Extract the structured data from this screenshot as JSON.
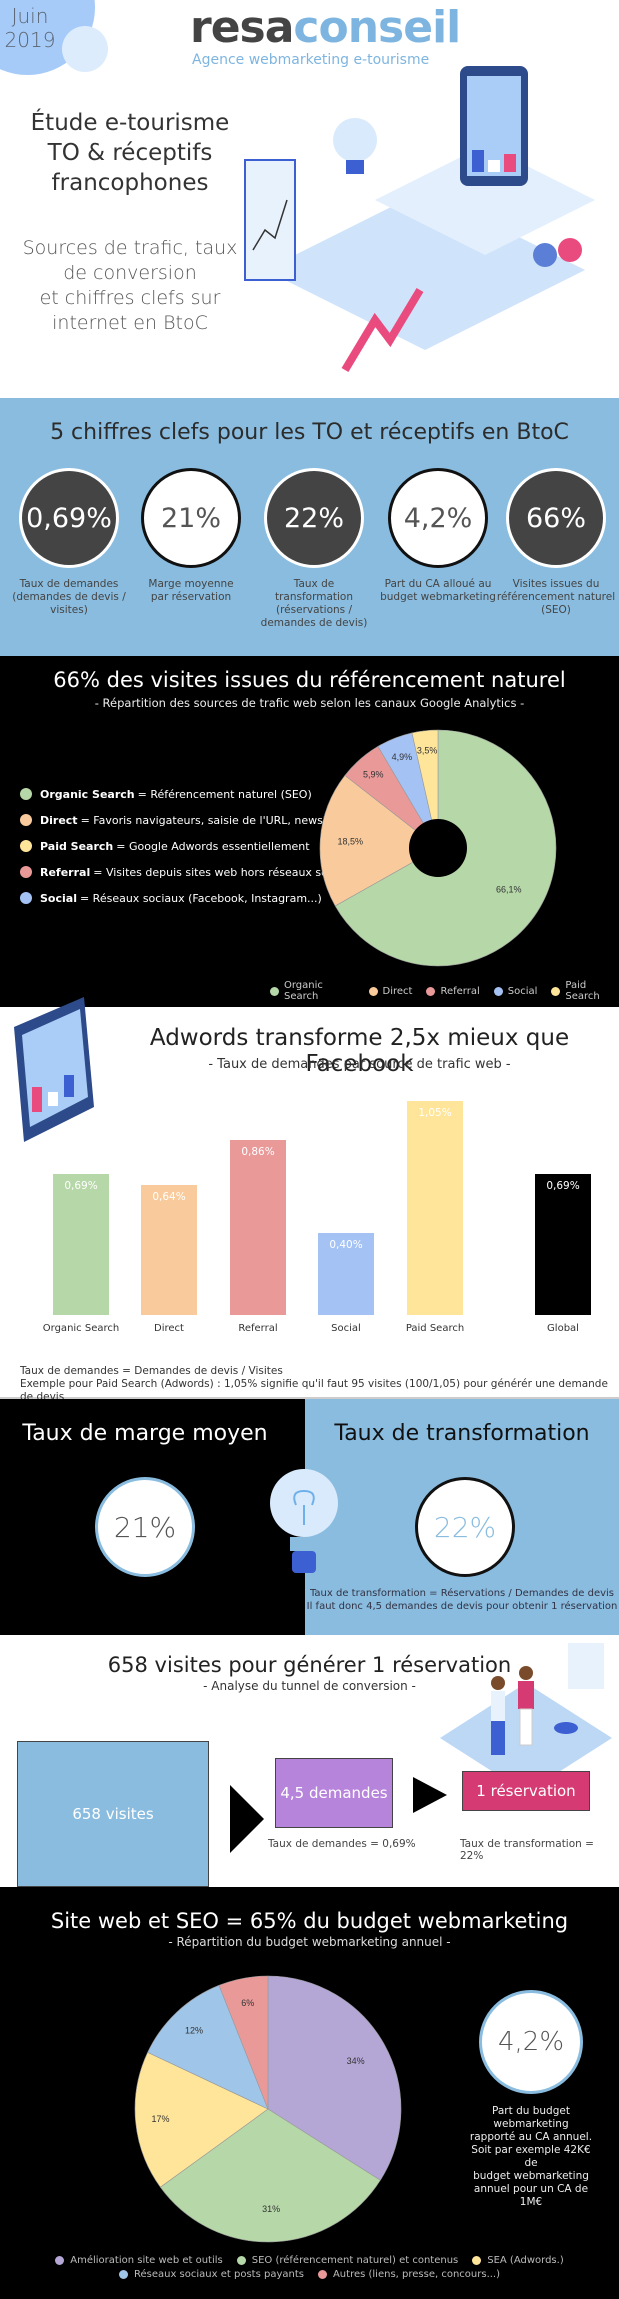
{
  "hero": {
    "date_line1": "Juin",
    "date_line2": "2019",
    "logo_part1": "resa",
    "logo_part2": "conseil",
    "tagline": "Agence webmarketing  e-tourisme",
    "title_lines": [
      "Étude e-tourisme",
      "TO & réceptifs",
      "francophones"
    ],
    "subtitle_lines": [
      "Sources de trafic, taux",
      "de conversion",
      "et chiffres clefs sur",
      "internet en BtoC"
    ]
  },
  "key_figures": {
    "title": "5 chiffres clefs pour les TO et réceptifs en BtoC",
    "items": [
      {
        "value": "0,69%",
        "style": "dark",
        "label_bold": "Taux de demandes",
        "label_rest": "(demandes de devis / visites)"
      },
      {
        "value": "21%",
        "style": "light",
        "label_bold": "Marge moyenne",
        "label_rest": "par réservation"
      },
      {
        "value": "22%",
        "style": "dark",
        "label_bold": "Taux de transformation",
        "label_rest": "(réservations / demandes de devis)"
      },
      {
        "value": "4,2%",
        "style": "light",
        "label_bold": "Part du CA alloué au",
        "label_rest": "budget webmarketing"
      },
      {
        "value": "66%",
        "style": "dark",
        "label_bold": "Visites issues du",
        "label_rest": "référencement naturel (SEO)"
      }
    ]
  },
  "traffic": {
    "title": "66% des visites issues du référencement naturel",
    "subtitle": "- Répartition des sources de trafic web selon les canaux Google Analytics -",
    "definitions": [
      {
        "key": "Organic Search",
        "text": "= Référencement naturel (SEO)",
        "color": "#b6d7a8"
      },
      {
        "key": "Direct",
        "text": "= Favoris navigateurs, saisie de l'URL, newsletters",
        "color": "#f9cb9c"
      },
      {
        "key": "Paid Search",
        "text": "= Google Adwords essentiellement",
        "color": "#ffe599"
      },
      {
        "key": "Referral",
        "text": "=  Visites depuis sites web hors réseaux sociaux",
        "color": "#ea9999"
      },
      {
        "key": "Social",
        "text": "= Réseaux sociaux (Facebook, Instagram...)",
        "color": "#a4c2f4"
      }
    ]
  },
  "adwords": {
    "title": "Adwords transforme 2,5x mieux que Facebook",
    "subtitle": "- Taux de demandes par source de trafic web -",
    "note_line1": "Taux de demandes = Demandes de devis / Visites",
    "note_line2": "Exemple pour Paid Search (Adwords) : 1,05% signifie qu'il faut 95 visites (100/1,05) pour générér une demande de devis"
  },
  "split": {
    "left_title": "Taux de marge moyen",
    "left_value": "21%",
    "right_title": "Taux de transformation",
    "right_value": "22%",
    "right_note_line1": "Taux de transformation = Réservations / Demandes de devis",
    "right_note_line2": "Il faut donc 4,5 demandes de devis pour obtenir 1 réservation"
  },
  "funnel": {
    "title": "658 visites pour générer 1 réservation",
    "subtitle": "- Analyse du tunnel de conversion -",
    "step1": "658 visites",
    "step2": "4,5 demandes",
    "step3": "1 réservation",
    "rate1": "Taux de demandes =  0,69%",
    "rate2": "Taux de transformation = 22%",
    "colors": {
      "step1": "#89bcdf",
      "step2": "#b784dc",
      "step3": "#d63a72"
    }
  },
  "budget": {
    "title": "Site web et SEO = 65% du budget webmarketing",
    "subtitle": "- Répartition du budget webmarketing annuel -",
    "share_value": "4,2%",
    "share_note": [
      "Part du budget",
      "webmarketing",
      "rapporté au CA annuel.",
      "Soit par exemple 42K€ de",
      "budget webmarketing",
      "annuel pour un CA de 1M€"
    ]
  },
  "chart_data": [
    {
      "type": "pie",
      "variant": "donut",
      "title": "66% des visites issues du référencement naturel",
      "subtitle": "- Répartition des sources de trafic web selon les canaux Google Analytics -",
      "categories": [
        "Organic Search",
        "Direct",
        "Referral",
        "Social",
        "Paid Search"
      ],
      "values": [
        66.1,
        18.5,
        5.9,
        4.9,
        3.5
      ],
      "labels": [
        "66,1%",
        "18,5%",
        "5,9%",
        "4,9%",
        "3,5%"
      ],
      "colors": [
        "#b6d7a8",
        "#f9cb9c",
        "#ea9999",
        "#a4c2f4",
        "#ffe599"
      ],
      "legend": "bottom"
    },
    {
      "type": "bar",
      "title": "Adwords transforme 2,5x mieux que Facebook",
      "subtitle": "- Taux de demandes par source de trafic web -",
      "categories": [
        "Organic Search",
        "Direct",
        "Referral",
        "Social",
        "Paid Search",
        "Global"
      ],
      "values": [
        0.69,
        0.64,
        0.86,
        0.4,
        1.05,
        0.69
      ],
      "labels": [
        "0,69%",
        "0,64%",
        "0,86%",
        "0,40%",
        "1,05%",
        "0,69%"
      ],
      "colors": [
        "#b6d7a8",
        "#f9cb9c",
        "#ea9999",
        "#a4c2f4",
        "#ffe599",
        "#000000"
      ],
      "xlabel": "",
      "ylabel": "",
      "ylim": [
        0,
        1.05
      ],
      "grid": false
    },
    {
      "type": "pie",
      "title": "Site web et SEO = 65% du budget webmarketing",
      "subtitle": "- Répartition du budget webmarketing annuel -",
      "categories": [
        "Amélioration site web et outils",
        "SEO (référencement naturel) et contenus",
        "SEA (Adwords.)",
        "Réseaux sociaux et posts payants",
        "Autres (liens, presse, concours...)"
      ],
      "values": [
        34,
        31,
        17,
        12,
        6
      ],
      "labels": [
        "34%",
        "31%",
        "17%",
        "12%",
        "6%"
      ],
      "colors": [
        "#b4a7d6",
        "#b6d7a8",
        "#ffe599",
        "#9fc5e8",
        "#ea9999"
      ],
      "legend": "bottom"
    }
  ]
}
